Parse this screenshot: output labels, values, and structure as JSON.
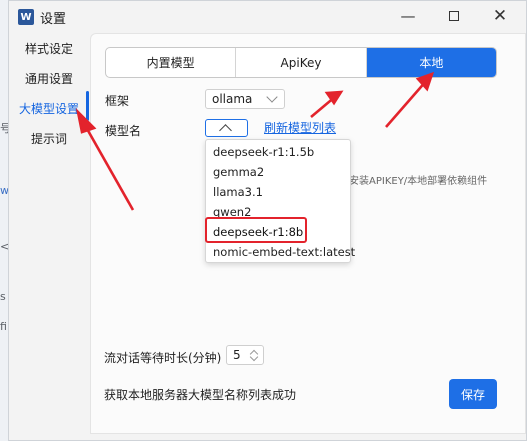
{
  "background": {
    "glyphs": [
      {
        "text": "号"
      },
      {
        "text": "w"
      },
      {
        "text": "<"
      },
      {
        "text": "s"
      },
      {
        "text": "fi"
      }
    ]
  },
  "window": {
    "app_icon": "W",
    "title": "设置",
    "controls": {
      "minimize": "—",
      "close": "✕"
    }
  },
  "sidebar": {
    "items": [
      {
        "label": "样式设定"
      },
      {
        "label": "通用设置"
      },
      {
        "label": "大模型设置"
      },
      {
        "label": "提示词"
      }
    ],
    "active_index": 2
  },
  "tabs": [
    {
      "label": "内置模型"
    },
    {
      "label": "ApiKey"
    },
    {
      "label": "本地"
    }
  ],
  "form": {
    "framework_label": "框架",
    "framework_value": "ollama",
    "model_label": "模型名",
    "refresh_link": "刷新模型列表",
    "hint": "安装APIKEY/本地部署依赖组件",
    "dropdown_options": [
      "deepseek-r1:1.5b",
      "gemma2",
      "llama3.1",
      "qwen2",
      "deepseek-r1:8b",
      "nomic-embed-text:latest"
    ],
    "highlighted_option": "deepseek-r1:8b",
    "timeout_label": "流对话等待时长(分钟)",
    "timeout_value": "5",
    "status": "获取本地服务器大模型名称列表成功",
    "save_label": "保存"
  },
  "colors": {
    "accent": "#1e6fe6",
    "annotation": "#e3232c"
  }
}
